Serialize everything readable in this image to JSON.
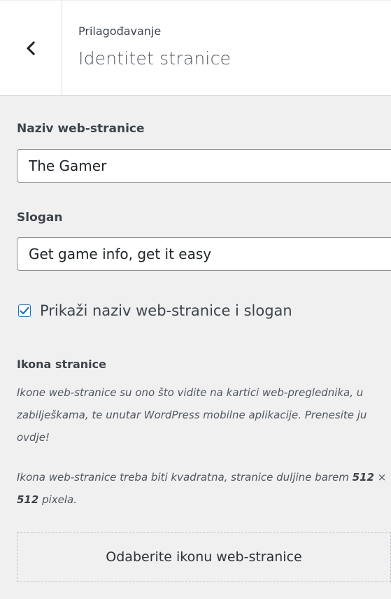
{
  "header": {
    "breadcrumb": "Prilagođavanje",
    "title": "Identitet stranice",
    "back_icon": "chevron-left-icon"
  },
  "site_title": {
    "label": "Naziv web-stranice",
    "value": "The Gamer"
  },
  "tagline": {
    "label": "Slogan",
    "value": "Get game info, get it easy"
  },
  "display_header_text": {
    "checked": true,
    "label": "Prikaži naziv web-stranice i slogan"
  },
  "site_icon": {
    "label": "Ikona stranice",
    "description_1": "Ikone web-stranice su ono što vidite na kartici web-preglednika, u zabilješkama, te unutar WordPress mobilne aplikacije. Prenesite ju ovdje!",
    "description_2_prefix": "Ikona web-stranice treba biti kvadratna, stranice duljine barem ",
    "size_width": "512",
    "size_sep": " × ",
    "size_height": "512",
    "description_2_suffix": " pixela.",
    "button_label": "Odaberite ikonu web-stranice"
  },
  "colors": {
    "accent": "#2271b1",
    "background": "#f0f0f1"
  }
}
